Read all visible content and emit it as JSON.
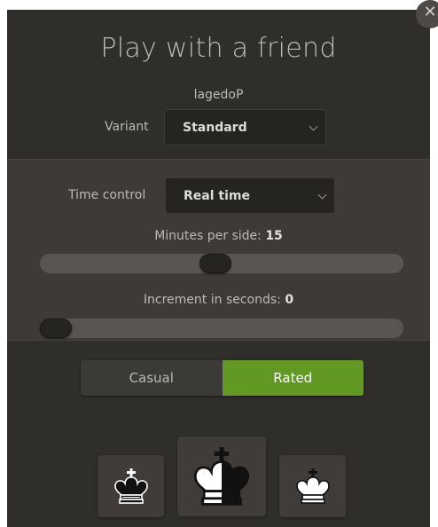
{
  "dialog": {
    "title": "Play with a friend",
    "opponent": "lagedoP",
    "close_symbol": "✕"
  },
  "variant": {
    "label": "Variant",
    "value": "Standard"
  },
  "time_control": {
    "label": "Time control",
    "value": "Real time"
  },
  "minutes": {
    "label": "Minutes per side:",
    "value": "15",
    "level": 0.48
  },
  "increment": {
    "label": "Increment in seconds:",
    "value": "0",
    "level": 0.0
  },
  "mode": {
    "casual": "Casual",
    "rated": "Rated",
    "selected": "rated"
  },
  "colors": {
    "accent": "#629924",
    "background": "#302e2b",
    "panel": "#3d3a37"
  },
  "color_choices": [
    {
      "name": "black",
      "icon": "black-king-icon"
    },
    {
      "name": "random",
      "icon": "half-king-icon"
    },
    {
      "name": "white",
      "icon": "white-king-icon"
    }
  ]
}
